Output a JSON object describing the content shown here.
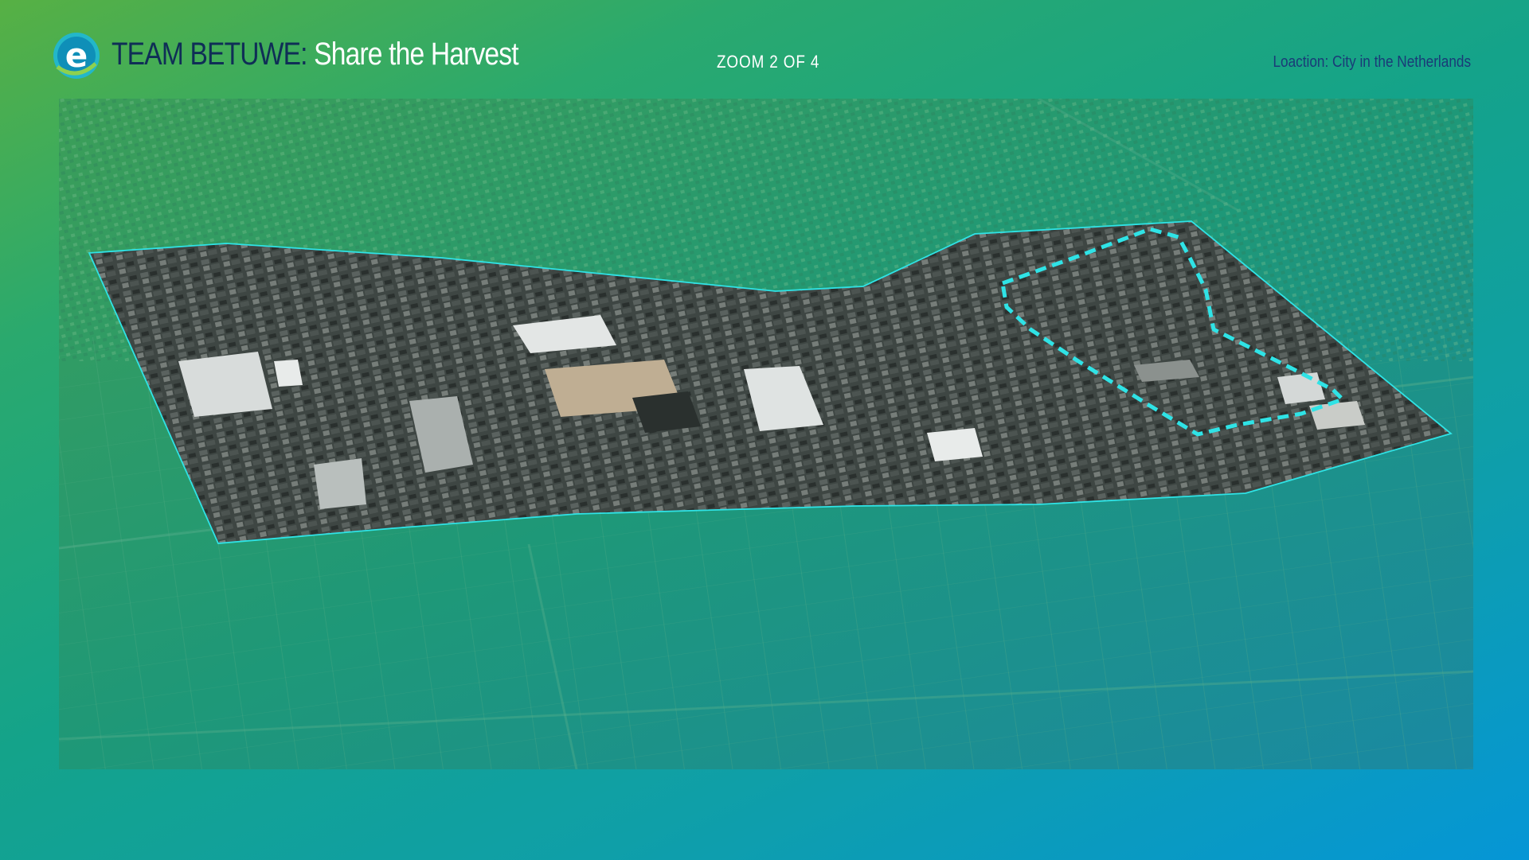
{
  "header": {
    "logo_letter": "e",
    "team": "TEAM BETUWE",
    "separator": ":",
    "tagline": "Share the Harvest",
    "zoom_label": "ZOOM 2 OF 4",
    "location": "Loaction: City in the Netherlands"
  },
  "map": {
    "description_icon": "aerial-map-icon"
  },
  "colors": {
    "accent_cyan": "#2fe3e6",
    "title_navy": "#0f2e56",
    "location_navy": "#1a3a78",
    "gradient_start": "#57b044",
    "gradient_end": "#0596d6"
  }
}
